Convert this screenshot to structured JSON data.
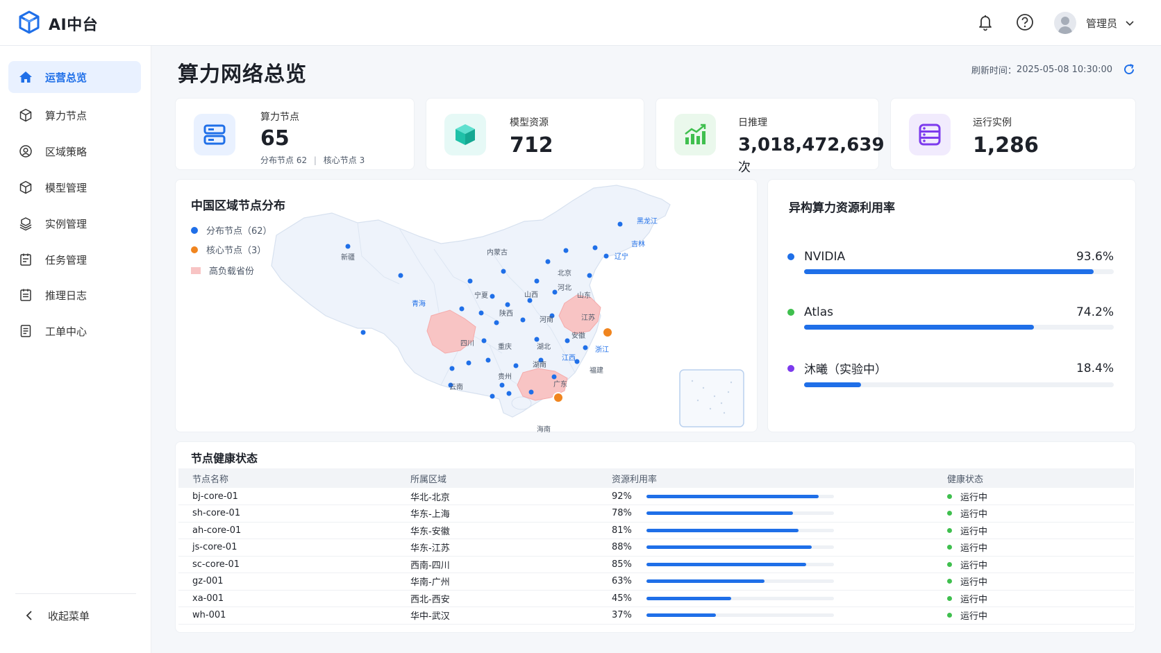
{
  "app": {
    "brand": "AI中台"
  },
  "header": {
    "user_name": "管理员"
  },
  "sidebar": {
    "items": [
      {
        "label": "运营总览",
        "icon": "home-icon",
        "active": true
      },
      {
        "label": "算力节点",
        "icon": "cube-icon"
      },
      {
        "label": "区域策略",
        "icon": "user-circle-icon"
      },
      {
        "label": "模型管理",
        "icon": "cube-icon"
      },
      {
        "label": "实例管理",
        "icon": "instances-icon"
      },
      {
        "label": "任务管理",
        "icon": "task-icon"
      },
      {
        "label": "推理日志",
        "icon": "log-icon"
      },
      {
        "label": "工单中心",
        "icon": "ticket-icon"
      }
    ],
    "collapse_label": "收起菜单"
  },
  "page": {
    "title": "算力网络总览",
    "refresh_label": "刷新时间：",
    "refresh_time": "2025-05-08 10:30:00"
  },
  "stats": {
    "nodes": {
      "label": "算力节点",
      "value": "65",
      "sub_distributed": "分布节点 62",
      "sub_sep": "|",
      "sub_core": "核心节点 3"
    },
    "models": {
      "label": "模型资源",
      "value": "712"
    },
    "inference": {
      "label": "日推理",
      "value": "3,018,472,639",
      "unit": "次"
    },
    "instances": {
      "label": "运行实例",
      "value": "1,286"
    }
  },
  "map": {
    "title": "中国区域节点分布",
    "legend": {
      "distributed": "分布节点（62）",
      "core": "核心节点（3）",
      "high_load": "高负载省份"
    },
    "provinces": {
      "xinjiang": "新疆",
      "qinghai": "青海",
      "neimenggu": "内蒙古",
      "heilongjiang": "黑龙江",
      "jilin": "吉林",
      "liaoning": "辽宁",
      "beijing": "北京",
      "hebei": "河北",
      "shanxi": "山西",
      "shandong": "山东",
      "ningxia": "宁夏",
      "shaanxi": "陕西",
      "henan": "河南",
      "jiangsu": "江苏",
      "anhui": "安徽",
      "zhejiang": "浙江",
      "hubei": "湖北",
      "sichuan": "四川",
      "chongqing": "重庆",
      "jiangxi": "江西",
      "hunan": "湖南",
      "fujian": "福建",
      "guizhou": "贵州",
      "yunnan": "云南",
      "guangdong": "广东",
      "hainan": "海南"
    }
  },
  "utilization": {
    "title": "异构算力资源利用率",
    "items": [
      {
        "name": "NVIDIA",
        "value": "93.6%",
        "fraction": 0.936,
        "color": "#1f6fe8"
      },
      {
        "name": "Atlas",
        "value": "74.2%",
        "fraction": 0.742,
        "color": "#3fbf4e"
      },
      {
        "name": "沐曦（实验中）",
        "value": "18.4%",
        "fraction": 0.184,
        "color": "#7c3aed"
      }
    ]
  },
  "health": {
    "title": "节点健康状态",
    "columns": [
      "节点名称",
      "所属区域",
      "资源利用率",
      "健康状态"
    ],
    "rows": [
      {
        "name": "bj-core-01",
        "region": "华北-北京",
        "util": "92%",
        "fraction": 0.92,
        "status": "运行中"
      },
      {
        "name": "sh-core-01",
        "region": "华东-上海",
        "util": "78%",
        "fraction": 0.78,
        "status": "运行中"
      },
      {
        "name": "ah-core-01",
        "region": "华东-安徽",
        "util": "81%",
        "fraction": 0.81,
        "status": "运行中"
      },
      {
        "name": "js-core-01",
        "region": "华东-江苏",
        "util": "88%",
        "fraction": 0.88,
        "status": "运行中"
      },
      {
        "name": "sc-core-01",
        "region": "西南-四川",
        "util": "85%",
        "fraction": 0.85,
        "status": "运行中"
      },
      {
        "name": "gz-001",
        "region": "华南-广州",
        "util": "63%",
        "fraction": 0.63,
        "status": "运行中"
      },
      {
        "name": "xa-001",
        "region": "西北-西安",
        "util": "45%",
        "fraction": 0.45,
        "status": "运行中"
      },
      {
        "name": "wh-001",
        "region": "华中-武汉",
        "util": "37%",
        "fraction": 0.37,
        "status": "运行中"
      }
    ]
  },
  "colors": {
    "accent": "#1f6fe8",
    "core": "#f0851f",
    "high_load": "#f8c4c4",
    "ok": "#3fbf4e"
  }
}
